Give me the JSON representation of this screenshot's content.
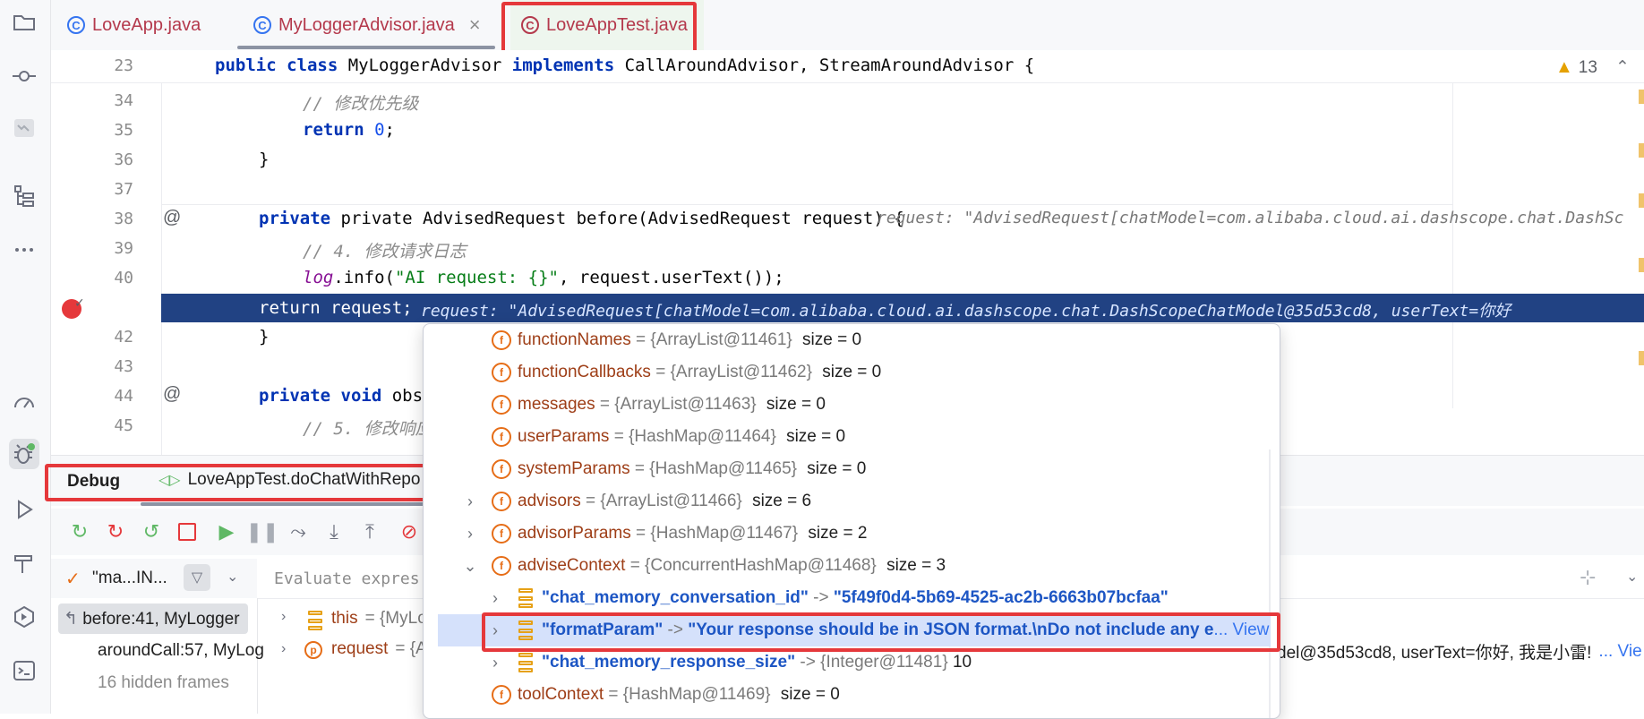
{
  "tabs": [
    {
      "label": "LoveApp.java",
      "icon": "class-icon"
    },
    {
      "label": "MyLoggerAdvisor.java",
      "icon": "class-icon",
      "closable": "×"
    },
    {
      "label": "LoveAppTest.java",
      "icon": "test-class-icon"
    }
  ],
  "editor": {
    "sticky": {
      "num": "23",
      "text": "public class MyLoggerAdvisor implements CallAroundAdvisor, StreamAroundAdvisor {"
    },
    "warnings": "13",
    "lines": [
      {
        "num": "34",
        "comment": "// 修改优先级"
      },
      {
        "num": "35",
        "kw": "return",
        "num_lit": "0",
        "rest": ";"
      },
      {
        "num": "36",
        "text": "}"
      },
      {
        "num": "37",
        "text": ""
      },
      {
        "num": "38",
        "text": "private AdvisedRequest before(AdvisedRequest request) {",
        "hint": "request: \"AdvisedRequest[chatModel=com.alibaba.cloud.ai.dashscope.chat.DashSc"
      },
      {
        "num": "39",
        "comment": "// 4. 修改请求日志"
      },
      {
        "num": "40",
        "field": "log",
        "mid": ".info(",
        "str": "\"AI request: {}\"",
        "rest": ", request.userText());"
      },
      {
        "num": "41",
        "text": "return request;",
        "hint": "request: \"AdvisedRequest[chatModel=com.alibaba.cloud.ai.dashscope.chat.DashScopeChatModel@35d53cd8, userText=你好"
      },
      {
        "num": "42",
        "text": "}"
      },
      {
        "num": "43",
        "text": ""
      },
      {
        "num": "44",
        "text": "private void observe"
      },
      {
        "num": "45",
        "comment": "// 5. 修改响应日志"
      }
    ]
  },
  "debug": {
    "tab_label": "Debug",
    "session_label": "LoveAppTest.doChatWithRepo",
    "thread_label": "\"ma...IN...",
    "evaluate_placeholder": "Evaluate expres",
    "frames": [
      {
        "label": "before:41, MyLogger"
      },
      {
        "label": "aroundCall:57, MyLog"
      },
      {
        "label": "16 hidden frames"
      }
    ],
    "vars": [
      {
        "name": "this",
        "value": "= {MyLo"
      },
      {
        "name": "request",
        "value": "= {A"
      }
    ],
    "request_tail": "del@35d53cd8, userText=你好, 我是小雷!",
    "request_view": "... Vie"
  },
  "popup": {
    "rows": [
      {
        "name": "functionNames",
        "type": "= {ArrayList@11461}",
        "size": "size = 0"
      },
      {
        "name": "functionCallbacks",
        "type": "= {ArrayList@11462}",
        "size": "size = 0"
      },
      {
        "name": "messages",
        "type": "= {ArrayList@11463}",
        "size": "size = 0"
      },
      {
        "name": "userParams",
        "type": "= {HashMap@11464}",
        "size": "size = 0"
      },
      {
        "name": "systemParams",
        "type": "= {HashMap@11465}",
        "size": "size = 0"
      },
      {
        "name": "advisors",
        "type": "= {ArrayList@11466}",
        "size": "size = 6"
      },
      {
        "name": "advisorParams",
        "type": "= {HashMap@11467}",
        "size": "size = 2"
      },
      {
        "name": "adviseContext",
        "type": "= {ConcurrentHashMap@11468}",
        "size": "size = 3"
      }
    ],
    "entries": [
      {
        "key": "\"chat_memory_conversation_id\"",
        "arrow": "->",
        "value": "\"5f49f0d4-5b69-4525-ac2b-6663b07bcfaa\""
      },
      {
        "key": "\"formatParam\"",
        "arrow": "->",
        "value": "\"Your response should be in JSON format.\\nDo not include any e",
        "view": "... View"
      },
      {
        "key": "\"chat_memory_response_size\"",
        "arrow": "->",
        "value": "{Integer@11481}",
        "extra": "10"
      }
    ],
    "tail": {
      "name": "toolContext",
      "type": "= {HashMap@11469}",
      "size": "size = 0"
    }
  },
  "colors": {
    "accent": "#3574f0",
    "highlight": "#e5383b",
    "exec_line": "#214283"
  }
}
